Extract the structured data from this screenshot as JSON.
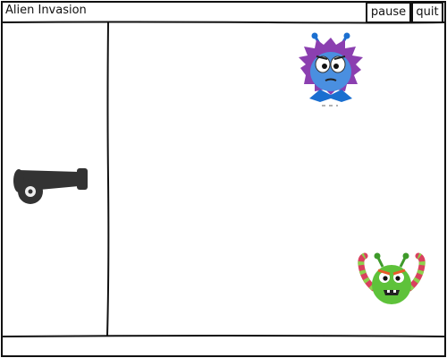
{
  "window": {
    "title": "Alien Invasion"
  },
  "toolbar": {
    "pause_label": "pause",
    "quit_label": "quit"
  },
  "game": {
    "player": {
      "type": "cannon",
      "icon": "cannon-icon"
    },
    "aliens": [
      {
        "name": "blue-purple-alien",
        "icon": "blue-alien-icon",
        "colors": [
          "#4a8fe0",
          "#8b3fb0",
          "#1a6fd0"
        ]
      },
      {
        "name": "green-alien",
        "icon": "green-alien-icon",
        "colors": [
          "#5ec23a",
          "#d9415f",
          "#e85b2a"
        ]
      }
    ]
  },
  "colors": {
    "outline": "#111111",
    "background": "#ffffff",
    "cannon": "#333333"
  }
}
